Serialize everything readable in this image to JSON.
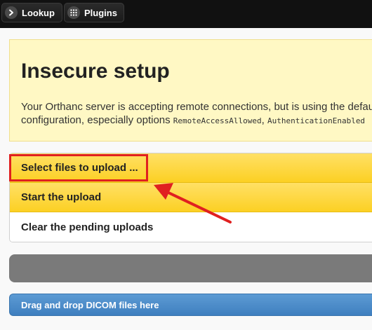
{
  "topbar": {
    "lookup_label": "Lookup",
    "plugins_label": "Plugins",
    "lookup_icon": "chevron-right-icon",
    "plugins_icon": "grid-icon"
  },
  "alert": {
    "title": "Insecure setup",
    "line1": "Your Orthanc server is accepting remote connections, but is using the default",
    "line2_prefix": "configuration, especially options ",
    "option1": "RemoteAccessAllowed",
    "separator": ", ",
    "option2": "AuthenticationEnabled"
  },
  "upload_menu": {
    "select_files": "Select files to upload ...",
    "start_upload": "Start the upload",
    "clear_pending": "Clear the pending uploads"
  },
  "drop_zone": {
    "label": "Drag and drop DICOM files here"
  },
  "colors": {
    "highlight": "#e02020",
    "button_yellow": "#fcd023",
    "drop_zone_blue": "#4a89c7"
  }
}
